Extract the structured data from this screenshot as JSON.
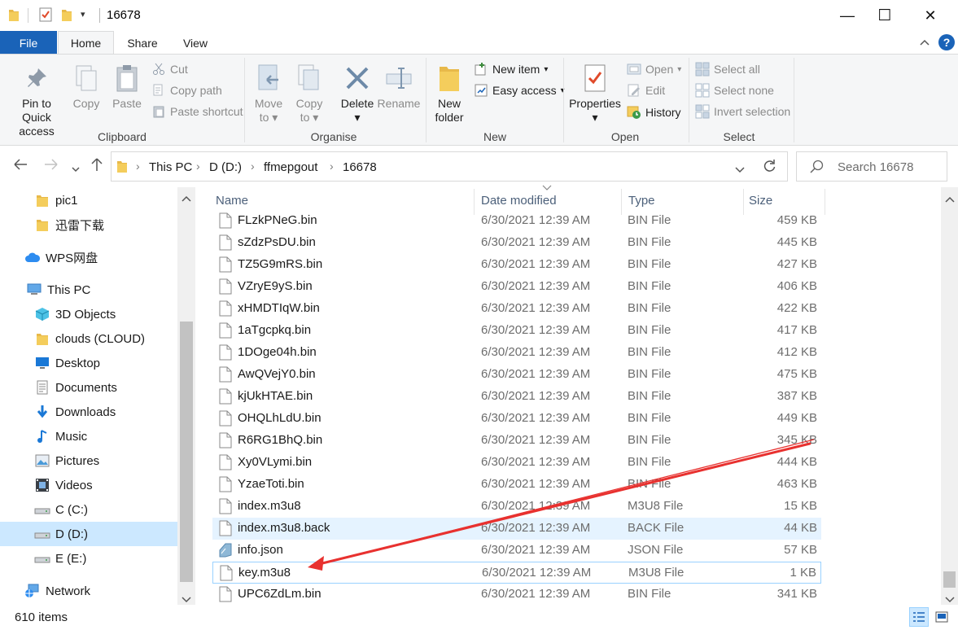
{
  "window": {
    "title": "16678",
    "minimize": "—",
    "maximize": "☐",
    "close": "✕"
  },
  "ribbon": {
    "tabs": {
      "file": "File",
      "home": "Home",
      "share": "Share",
      "view": "View"
    },
    "clipboard": {
      "group": "Clipboard",
      "pin_line1": "Pin to Quick",
      "pin_line2": "access",
      "copy": "Copy",
      "paste": "Paste",
      "cut": "Cut",
      "copy_path": "Copy path",
      "paste_shortcut": "Paste shortcut"
    },
    "organise": {
      "group": "Organise",
      "move_line1": "Move",
      "move_line2": "to",
      "copy_line1": "Copy",
      "copy_line2": "to",
      "delete": "Delete",
      "rename": "Rename"
    },
    "new": {
      "group": "New",
      "new_folder_line1": "New",
      "new_folder_line2": "folder",
      "new_item": "New item",
      "easy_access": "Easy access"
    },
    "open": {
      "group": "Open",
      "properties": "Properties",
      "open": "Open",
      "edit": "Edit",
      "history": "History"
    },
    "select": {
      "group": "Select",
      "select_all": "Select all",
      "select_none": "Select none",
      "invert": "Invert selection"
    }
  },
  "address": {
    "crumbs": [
      "This PC",
      "D (D:)",
      "ffmepgout",
      "16678"
    ],
    "search_placeholder": "Search 16678"
  },
  "nav": {
    "items": [
      {
        "label": "pic1",
        "icon": "folder-icon"
      },
      {
        "label": "迅雷下载",
        "icon": "folder-icon"
      },
      {
        "label": "WPS网盘",
        "icon": "cloud-icon"
      },
      {
        "label": "This PC",
        "icon": "pc-icon"
      },
      {
        "label": "3D Objects",
        "icon": "cube-icon"
      },
      {
        "label": "clouds (CLOUD)",
        "icon": "folder-icon"
      },
      {
        "label": "Desktop",
        "icon": "desktop-icon"
      },
      {
        "label": "Documents",
        "icon": "documents-icon"
      },
      {
        "label": "Downloads",
        "icon": "downloads-icon"
      },
      {
        "label": "Music",
        "icon": "music-icon"
      },
      {
        "label": "Pictures",
        "icon": "pictures-icon"
      },
      {
        "label": "Videos",
        "icon": "videos-icon"
      },
      {
        "label": "C (C:)",
        "icon": "drive-icon"
      },
      {
        "label": "D (D:)",
        "icon": "drive-icon"
      },
      {
        "label": "E (E:)",
        "icon": "drive-icon"
      },
      {
        "label": "Network",
        "icon": "network-icon"
      }
    ],
    "selected": "D (D:)"
  },
  "columns": {
    "name": "Name",
    "date": "Date modified",
    "type": "Type",
    "size": "Size"
  },
  "files": [
    {
      "name": "FLzkPNeG.bin",
      "date": "6/30/2021 12:39 AM",
      "type": "BIN File",
      "size": "459 KB"
    },
    {
      "name": "sZdzPsDU.bin",
      "date": "6/30/2021 12:39 AM",
      "type": "BIN File",
      "size": "445 KB"
    },
    {
      "name": "TZ5G9mRS.bin",
      "date": "6/30/2021 12:39 AM",
      "type": "BIN File",
      "size": "427 KB"
    },
    {
      "name": "VZryE9yS.bin",
      "date": "6/30/2021 12:39 AM",
      "type": "BIN File",
      "size": "406 KB"
    },
    {
      "name": "xHMDTIqW.bin",
      "date": "6/30/2021 12:39 AM",
      "type": "BIN File",
      "size": "422 KB"
    },
    {
      "name": "1aTgcpkq.bin",
      "date": "6/30/2021 12:39 AM",
      "type": "BIN File",
      "size": "417 KB"
    },
    {
      "name": "1DOge04h.bin",
      "date": "6/30/2021 12:39 AM",
      "type": "BIN File",
      "size": "412 KB"
    },
    {
      "name": "AwQVejY0.bin",
      "date": "6/30/2021 12:39 AM",
      "type": "BIN File",
      "size": "475 KB"
    },
    {
      "name": "kjUkHTAE.bin",
      "date": "6/30/2021 12:39 AM",
      "type": "BIN File",
      "size": "387 KB"
    },
    {
      "name": "OHQLhLdU.bin",
      "date": "6/30/2021 12:39 AM",
      "type": "BIN File",
      "size": "449 KB"
    },
    {
      "name": "R6RG1BhQ.bin",
      "date": "6/30/2021 12:39 AM",
      "type": "BIN File",
      "size": "345 KB"
    },
    {
      "name": "Xy0VLymi.bin",
      "date": "6/30/2021 12:39 AM",
      "type": "BIN File",
      "size": "444 KB"
    },
    {
      "name": "YzaeToti.bin",
      "date": "6/30/2021 12:39 AM",
      "type": "BIN File",
      "size": "463 KB"
    },
    {
      "name": "index.m3u8",
      "date": "6/30/2021 12:39 AM",
      "type": "M3U8 File",
      "size": "15 KB"
    },
    {
      "name": "index.m3u8.back",
      "date": "6/30/2021 12:39 AM",
      "type": "BACK File",
      "size": "44 KB"
    },
    {
      "name": "info.json",
      "date": "6/30/2021 12:39 AM",
      "type": "JSON File",
      "size": "57 KB"
    },
    {
      "name": "key.m3u8",
      "date": "6/30/2021 12:39 AM",
      "type": "M3U8 File",
      "size": "1 KB"
    },
    {
      "name": "UPC6ZdLm.bin",
      "date": "6/30/2021 12:39 AM",
      "type": "BIN File",
      "size": "341 KB"
    }
  ],
  "status": {
    "item_count": "610 items"
  },
  "colors": {
    "accent": "#1a63b8",
    "selection": "#cce8ff",
    "hover": "#e5f3ff",
    "annotation_arrow": "#e8312f"
  }
}
